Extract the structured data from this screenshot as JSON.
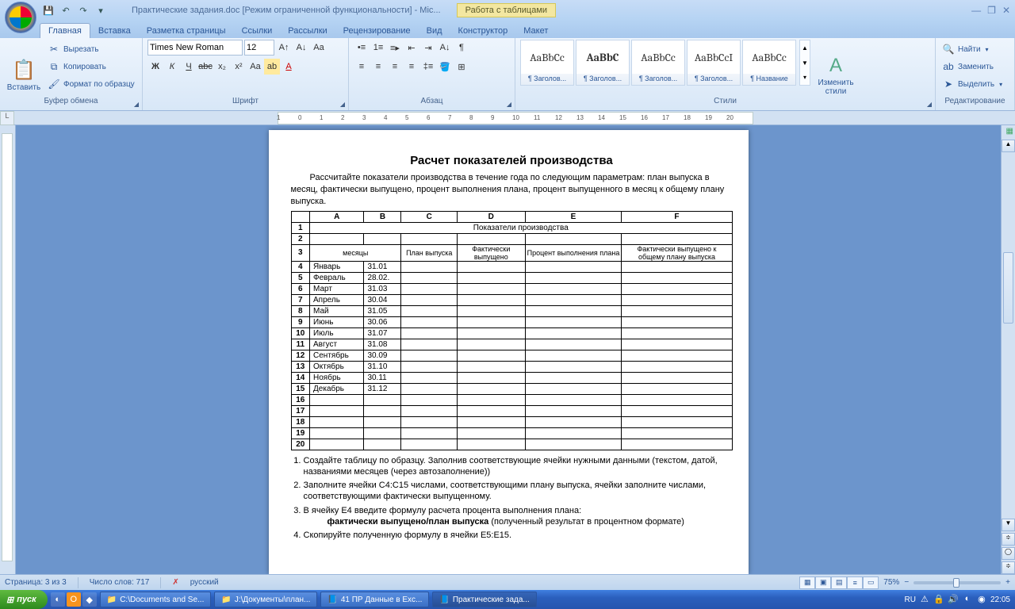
{
  "title": "Практические задания.doc [Режим ограниченной функциональности] - Mic...",
  "context_tab": "Работа с таблицами",
  "tabs": [
    "Главная",
    "Вставка",
    "Разметка страницы",
    "Ссылки",
    "Рассылки",
    "Рецензирование",
    "Вид",
    "Конструктор",
    "Макет"
  ],
  "active_tab": 0,
  "ribbon": {
    "clipboard": {
      "label": "Буфер обмена",
      "paste": "Вставить",
      "cut": "Вырезать",
      "copy": "Копировать",
      "format": "Формат по образцу"
    },
    "font": {
      "label": "Шрифт",
      "name": "Times New Roman",
      "size": "12"
    },
    "paragraph": {
      "label": "Абзац"
    },
    "styles": {
      "label": "Стили",
      "change": "Изменить\nстили",
      "items": [
        {
          "preview": "AaBbCc",
          "caption": "¶ Заголов..."
        },
        {
          "preview": "AaBbC",
          "caption": "¶ Заголов...",
          "bold": true
        },
        {
          "preview": "AaBbCc",
          "caption": "¶ Заголов..."
        },
        {
          "preview": "AaBbCcI",
          "caption": "¶ Заголов..."
        },
        {
          "preview": "AaBbCc",
          "caption": "¶ Название"
        }
      ]
    },
    "editing": {
      "label": "Редактирование",
      "find": "Найти",
      "replace": "Заменить",
      "select": "Выделить"
    }
  },
  "document": {
    "title": "Расчет показателей производства",
    "intro": "Рассчитайте показатели производства в течение года по следующим параметрам: план выпуска в месяц,  фактически выпущено, процент выполнения плана, процент выпущенного в месяц к общему плану выпуска.",
    "cols": [
      "A",
      "B",
      "C",
      "D",
      "E",
      "F"
    ],
    "table_title": "Показатели производства",
    "headers": [
      "месяцы",
      "",
      "План выпуска",
      "Фактически выпущено",
      "Процент выполнения плана",
      "Фактически выпущено к общему плану выпуска"
    ],
    "rows": [
      {
        "n": "4",
        "m": "Январь",
        "d": "31.01"
      },
      {
        "n": "5",
        "m": "Февраль",
        "d": "28.02."
      },
      {
        "n": "6",
        "m": "Март",
        "d": "31.03"
      },
      {
        "n": "7",
        "m": "Апрель",
        "d": "30.04"
      },
      {
        "n": "8",
        "m": "Май",
        "d": "31.05"
      },
      {
        "n": "9",
        "m": "Июнь",
        "d": "30.06"
      },
      {
        "n": "10",
        "m": "Июль",
        "d": "31.07"
      },
      {
        "n": "11",
        "m": "Август",
        "d": "31.08"
      },
      {
        "n": "12",
        "m": "Сентябрь",
        "d": "30.09"
      },
      {
        "n": "13",
        "m": "Октябрь",
        "d": "31.10"
      },
      {
        "n": "14",
        "m": "Ноябрь",
        "d": "30.11"
      },
      {
        "n": "15",
        "m": "Декабрь",
        "d": "31.12"
      },
      {
        "n": "16",
        "m": "",
        "d": ""
      },
      {
        "n": "17",
        "m": "",
        "d": ""
      },
      {
        "n": "18",
        "m": "",
        "d": ""
      },
      {
        "n": "19",
        "m": "",
        "d": ""
      },
      {
        "n": "20",
        "m": "",
        "d": ""
      }
    ],
    "notes": [
      "Создайте таблицу по образцу. Заполнив соответствующие ячейки нужными данными (текстом,  датой, названиями месяцев (через автозаполнение))",
      "Заполните  ячейки C4:C15 числами, соответствующими плану выпуска, ячейки заполните числами, соответствующими фактически выпущенному.",
      "В ячейку E4 введите формулу расчета процента выполнения плана:",
      "Скопируйте полученную формулу в ячейки E5:E15."
    ],
    "formula": "фактически выпущено/план выпуска",
    "formula_tail": " (полученный результат в процентном формате)"
  },
  "status": {
    "page": "Страница: 3 из 3",
    "words": "Число слов: 717",
    "lang": "русский",
    "zoom": "75%"
  },
  "taskbar": {
    "start": "пуск",
    "tasks": [
      {
        "icon": "📁",
        "label": "C:\\Documents and Se..."
      },
      {
        "icon": "📁",
        "label": "J:\\Документы\\план..."
      },
      {
        "icon": "📘",
        "label": "41 ПР Данные в Exc..."
      },
      {
        "icon": "📘",
        "label": "Практические зада...",
        "active": true
      }
    ],
    "lang": "RU",
    "time": "22:05"
  }
}
